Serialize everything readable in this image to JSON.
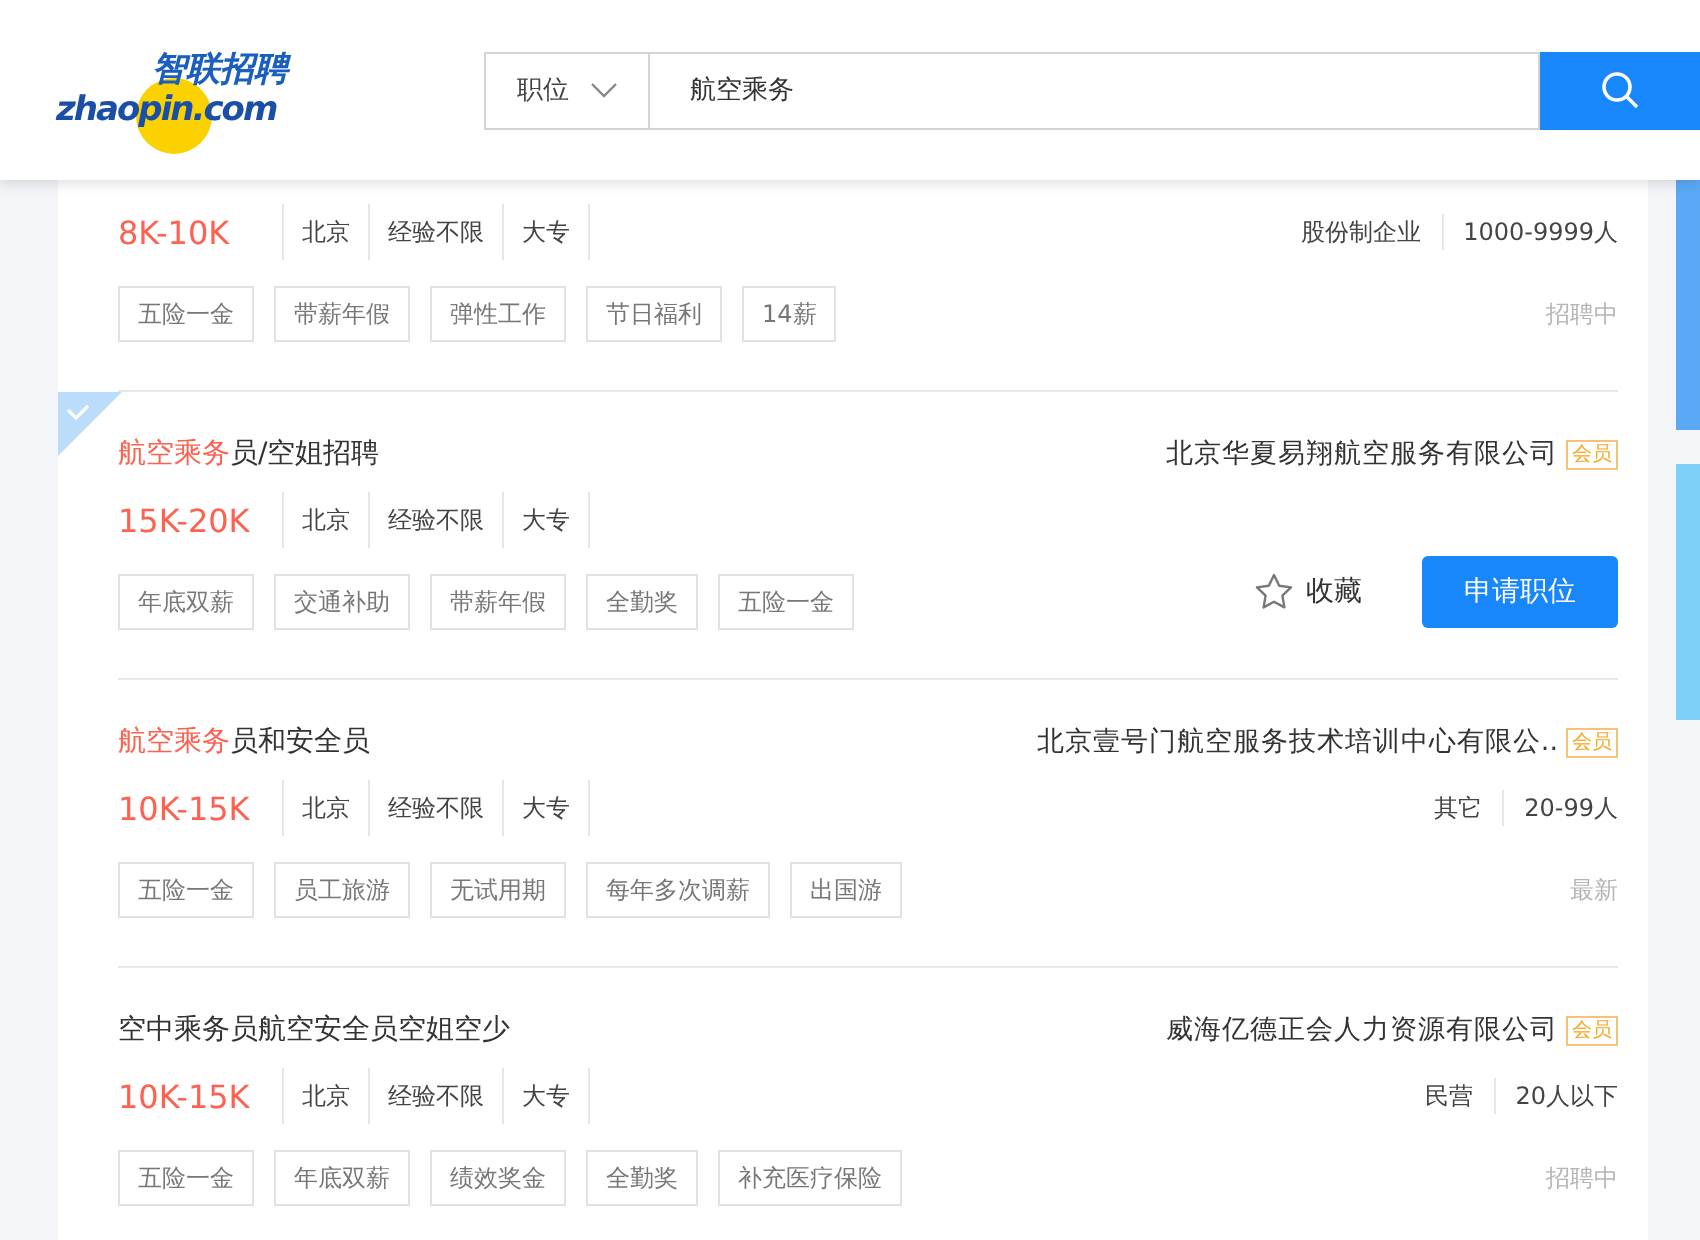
{
  "header": {
    "logo": {
      "cn": "智联招聘",
      "en": "zhaopin.com"
    },
    "search": {
      "category": "职位",
      "value": "航空乘务"
    }
  },
  "jobs": [
    {
      "checked": false,
      "salary": "8K-10K",
      "meta": [
        "北京",
        "经验不限",
        "大专"
      ],
      "company_meta": [
        "股份制企业",
        "1000-9999人"
      ],
      "tags": [
        "五险一金",
        "带薪年假",
        "弹性工作",
        "节日福利",
        "14薪"
      ],
      "status": "招聘中"
    },
    {
      "checked": true,
      "title": [
        {
          "text": "航空乘务",
          "highlight": true
        },
        {
          "text": "员/空姐招聘",
          "highlight": false
        }
      ],
      "company": "北京华夏易翔航空服务有限公司",
      "badge": "会员",
      "salary": "15K-20K",
      "meta": [
        "北京",
        "经验不限",
        "大专"
      ],
      "tags": [
        "年底双薪",
        "交通补助",
        "带薪年假",
        "全勤奖",
        "五险一金"
      ],
      "favorite": "收藏",
      "apply": "申请职位"
    },
    {
      "checked": false,
      "title": [
        {
          "text": "航空乘务",
          "highlight": true
        },
        {
          "text": "员和安全员",
          "highlight": false
        }
      ],
      "company": "北京壹号门航空服务技术培训中心有限公..",
      "badge": "会员",
      "salary": "10K-15K",
      "meta": [
        "北京",
        "经验不限",
        "大专"
      ],
      "company_meta": [
        "其它",
        "20-99人"
      ],
      "tags": [
        "五险一金",
        "员工旅游",
        "无试用期",
        "每年多次调薪",
        "出国游"
      ],
      "status": "最新"
    },
    {
      "checked": false,
      "title": [
        {
          "text": "空中乘务员航空安全员空姐空少",
          "highlight": false
        }
      ],
      "company": "威海亿德正会人力资源有限公司",
      "badge": "会员",
      "salary": "10K-15K",
      "meta": [
        "北京",
        "经验不限",
        "大专"
      ],
      "company_meta": [
        "民营",
        "20人以下"
      ],
      "tags": [
        "五险一金",
        "年底双薪",
        "绩效奖金",
        "全勤奖",
        "补充医疗保险"
      ],
      "status": "招聘中"
    }
  ]
}
